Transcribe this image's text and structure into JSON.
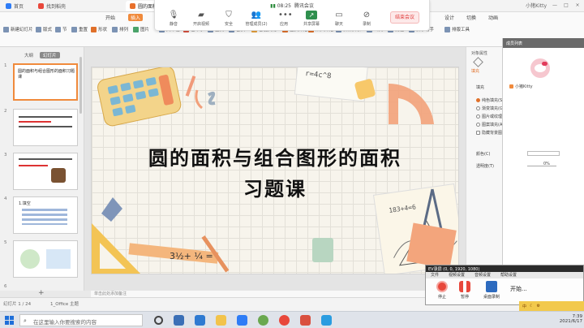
{
  "titlebar": {
    "tabs": [
      {
        "label": "首页"
      },
      {
        "label": "找到稻壳"
      },
      {
        "label": "圆的面积..."
      }
    ],
    "user": "小猪Kitty"
  },
  "meeting": {
    "signal": "08:25",
    "title": "腾讯会议",
    "tools": [
      "静音",
      "开启视频",
      "安全",
      "管理成员(2)",
      "应用",
      "共享屏幕",
      "聊天",
      "录制",
      "开始云录"
    ],
    "end_label": "结束会议"
  },
  "ribbon": {
    "tabs": [
      "开始",
      "插入",
      "设计",
      "切换",
      "动画",
      "放映",
      "审阅",
      "视图",
      "开发工具",
      "会员专享",
      "稻壳资源"
    ],
    "buttons": [
      "新建幻灯片",
      "版式",
      "节",
      "重置",
      "形状",
      "排列",
      "图片",
      "文本框",
      "艺术字",
      "查找",
      "替换",
      "智能美化",
      "当页开始",
      "从头开始",
      "演讲实录",
      "公式",
      "批注",
      "演示助手",
      "排版工具"
    ]
  },
  "slide_panel": {
    "tabs": [
      "大纲",
      "幻灯片"
    ],
    "thumbs": [
      {
        "num": "1",
        "text": "圆的面积与组合图形的面积习题课"
      },
      {
        "num": "2",
        "text": ""
      },
      {
        "num": "3",
        "text": ""
      },
      {
        "num": "4",
        "text": "1.填空"
      },
      {
        "num": "5",
        "text": ""
      },
      {
        "num": "6",
        "text": ""
      }
    ]
  },
  "slide": {
    "title": "圆的面积与组合图形的面积",
    "subtitle": "习题课",
    "decor": {
      "note_formula": "r=4c^8",
      "paper_numbers": "183+4=6",
      "fraction": "3½+ ¼ =",
      "icons": [
        "calculator",
        "protractor",
        "ruler",
        "pencil",
        "compass",
        "paper-clip",
        "eraser",
        "triangle-ruler"
      ]
    }
  },
  "props": {
    "header": "对象属性",
    "fill_tab": "填充",
    "fill_label": "填充",
    "options": [
      "纯色填充(S)",
      "渐变填充(G)",
      "图片或纹理填充(P)",
      "图案填充(A)",
      "隐藏背景图形(H)"
    ],
    "color_label": "颜色(C)",
    "transparency_label": "透明度(T)",
    "transparency_value": "0%"
  },
  "people": {
    "header": "成员列表",
    "name": "小猪Kitty"
  },
  "statusbar": {
    "slide_info": "幻灯片 1 / 24",
    "theme": "1_Office 主题",
    "notes_placeholder": "单击此处添加备注"
  },
  "recorder": {
    "title": "EV录屏 (0, 0, 1920, 1080)",
    "menu": [
      "文件",
      "视频设置",
      "音频设置",
      "帮助设置"
    ],
    "start": "停止",
    "pause": "暂停",
    "screen": "桌面录制",
    "status": "开始..."
  },
  "ime": {
    "label": "中"
  },
  "taskbar": {
    "search_placeholder": "在这里输入你要搜索的内容",
    "time": "7:39",
    "date": "2021/6/17"
  }
}
